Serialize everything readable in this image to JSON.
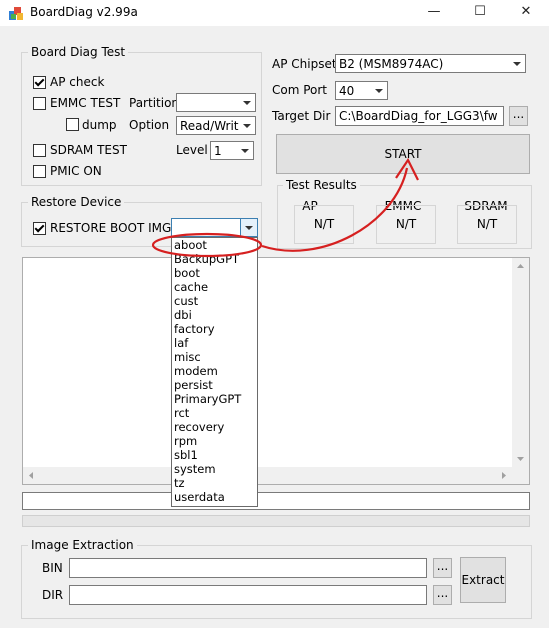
{
  "window": {
    "title": "BoardDiag v2.99a",
    "min": "—",
    "max": "☐",
    "close": "✕"
  },
  "board_diag": {
    "group_title": "Board Diag Test",
    "ap_check": {
      "label": "AP check",
      "checked": true
    },
    "emmc_test": {
      "label": "EMMC TEST",
      "checked": false
    },
    "partition": {
      "label": "Partition",
      "value": ""
    },
    "dump": {
      "label": "dump",
      "checked": false
    },
    "option": {
      "label": "Option",
      "value": "Read/Writ"
    },
    "sdram_test": {
      "label": "SDRAM TEST",
      "checked": false
    },
    "level": {
      "label": "Level",
      "value": "1"
    },
    "pmic_on": {
      "label": "PMIC ON",
      "checked": false
    }
  },
  "restore": {
    "group_title": "Restore Device",
    "restore_boot_img": {
      "label": "RESTORE BOOT IMG",
      "checked": true
    },
    "image_value": "",
    "dropdown_items": [
      "aboot",
      "BackupGPT",
      "boot",
      "cache",
      "cust",
      "dbi",
      "factory",
      "laf",
      "misc",
      "modem",
      "persist",
      "PrimaryGPT",
      "rct",
      "recovery",
      "rpm",
      "sbl1",
      "system",
      "tz",
      "userdata"
    ]
  },
  "settings": {
    "ap_chipset": {
      "label": "AP Chipset",
      "value": "B2 (MSM8974AC)"
    },
    "com_port": {
      "label": "Com Port",
      "value": "40"
    },
    "target_dir": {
      "label": "Target Dir",
      "value": "C:\\BoardDiag_for_LGG3\\fw",
      "browse": "..."
    },
    "start_label": "START"
  },
  "test_results": {
    "group_title": "Test Results",
    "items": [
      {
        "label": "AP",
        "value": "N/T"
      },
      {
        "label": "EMMC",
        "value": "N/T"
      },
      {
        "label": "SDRAM",
        "value": "N/T"
      }
    ]
  },
  "image_extraction": {
    "group_title": "Image Extraction",
    "bin_label": "BIN",
    "bin_value": "",
    "dir_label": "DIR",
    "dir_value": "",
    "browse": "...",
    "extract_label": "Extract"
  },
  "colors": {
    "annotation": "#d62020"
  }
}
